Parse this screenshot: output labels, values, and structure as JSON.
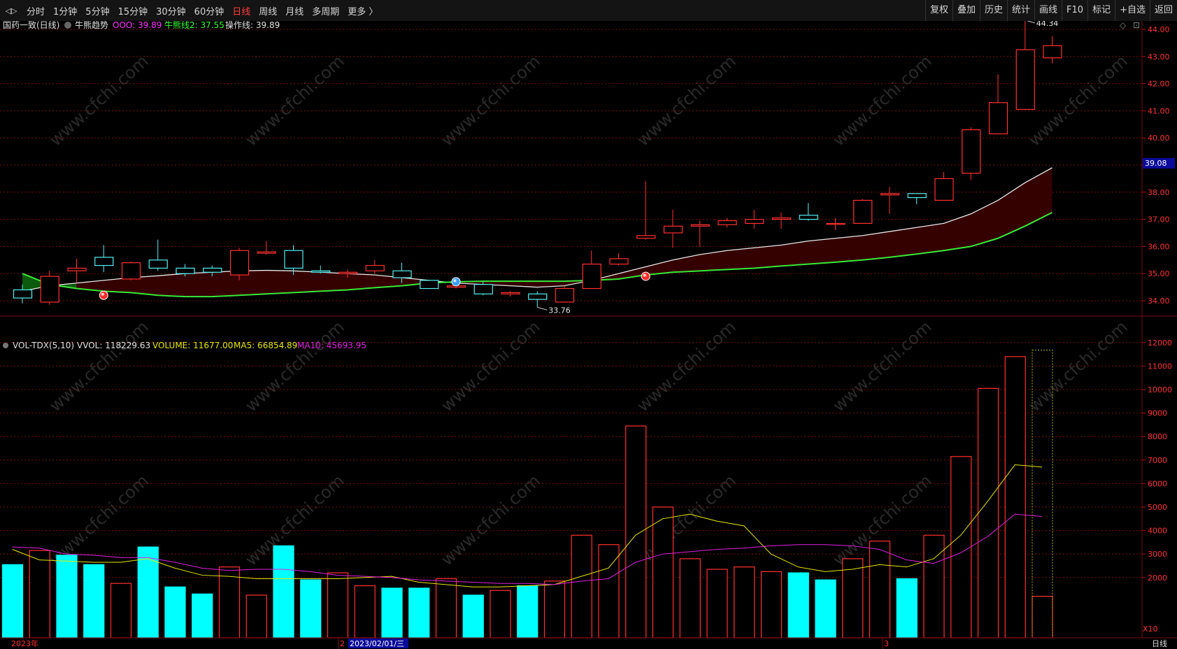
{
  "toolbar": {
    "nav_arrows": "◁▷",
    "periods": [
      "分时",
      "1分钟",
      "5分钟",
      "15分钟",
      "30分钟",
      "60分钟",
      "日线",
      "周线",
      "月线",
      "多周期",
      "更多 〉"
    ],
    "active_period": "日线",
    "right_buttons": [
      "复权",
      "叠加",
      "历史",
      "统计",
      "画线",
      "F10",
      "标记",
      "+自选",
      "返回"
    ]
  },
  "main_legend": {
    "stock": "国药一致(日线)",
    "indicator": "牛熊趋势",
    "ooo": "OOO: 39.89",
    "line2": "牛熊线2: 37.55",
    "op_line": "操作线: 39.89"
  },
  "vol_legend": {
    "name": "VOL-TDX(5,10)",
    "vvol": "VVOL: 118229.63",
    "volume": "VOLUME: 11677.00",
    "ma5": "MA5: 66854.89",
    "ma10": "MA10: 45693.95"
  },
  "price_labels": {
    "high": "44.34",
    "low": "33.76",
    "current": "39.08"
  },
  "vol_multiplier": "X10",
  "time_axis": {
    "labels": [
      "2023年",
      "2",
      "2023/02/01/三",
      "3"
    ],
    "mode": "日线"
  },
  "watermark": "www.cfchi.com",
  "colors": {
    "up": "#ff3030",
    "down": "#55f0f0",
    "bg": "#000000",
    "grid": "#7a0c0c",
    "ma_white": "#e8e8e8",
    "ma_green": "#39e839",
    "vol_ma5": "#e6e600",
    "vol_ma10": "#e020e0",
    "fill_dark": "#3a0000"
  },
  "chart_data": [
    {
      "type": "candlestick",
      "ylim": [
        33.5,
        44.5
      ],
      "yticks": [
        34,
        35,
        36,
        37,
        38,
        39,
        40,
        41,
        42,
        43,
        44
      ],
      "candles": [
        {
          "o": 34.4,
          "h": 34.6,
          "l": 33.9,
          "c": 34.1
        },
        {
          "o": 33.95,
          "h": 35.1,
          "l": 33.85,
          "c": 34.9
        },
        {
          "o": 35.1,
          "h": 35.55,
          "l": 34.65,
          "c": 35.2
        },
        {
          "o": 35.6,
          "h": 36.05,
          "l": 35.05,
          "c": 35.3
        },
        {
          "o": 34.8,
          "h": 35.45,
          "l": 34.75,
          "c": 35.4
        },
        {
          "o": 35.5,
          "h": 36.25,
          "l": 35.1,
          "c": 35.2
        },
        {
          "o": 35.2,
          "h": 35.35,
          "l": 34.9,
          "c": 35.0
        },
        {
          "o": 35.2,
          "h": 35.3,
          "l": 34.9,
          "c": 35.05
        },
        {
          "o": 34.95,
          "h": 35.95,
          "l": 34.75,
          "c": 35.85
        },
        {
          "o": 35.75,
          "h": 36.2,
          "l": 35.7,
          "c": 35.8
        },
        {
          "o": 35.85,
          "h": 36.05,
          "l": 34.95,
          "c": 35.2
        },
        {
          "o": 35.1,
          "h": 35.3,
          "l": 35.0,
          "c": 35.05
        },
        {
          "o": 35.0,
          "h": 35.15,
          "l": 34.85,
          "c": 35.05
        },
        {
          "o": 35.1,
          "h": 35.5,
          "l": 35.0,
          "c": 35.3
        },
        {
          "o": 35.1,
          "h": 35.4,
          "l": 34.65,
          "c": 34.85
        },
        {
          "o": 34.75,
          "h": 34.75,
          "l": 34.45,
          "c": 34.45
        },
        {
          "o": 34.5,
          "h": 34.6,
          "l": 34.45,
          "c": 34.55
        },
        {
          "o": 34.6,
          "h": 34.7,
          "l": 34.2,
          "c": 34.25
        },
        {
          "o": 34.25,
          "h": 34.35,
          "l": 34.15,
          "c": 34.3
        },
        {
          "o": 34.25,
          "h": 34.35,
          "l": 33.76,
          "c": 34.05
        },
        {
          "o": 33.95,
          "h": 34.55,
          "l": 33.95,
          "c": 34.45
        },
        {
          "o": 34.45,
          "h": 35.85,
          "l": 34.45,
          "c": 35.35
        },
        {
          "o": 35.35,
          "h": 35.75,
          "l": 35.3,
          "c": 35.55
        },
        {
          "o": 36.3,
          "h": 38.4,
          "l": 36.25,
          "c": 36.4
        },
        {
          "o": 36.5,
          "h": 37.35,
          "l": 35.95,
          "c": 36.75
        },
        {
          "o": 36.75,
          "h": 36.95,
          "l": 36.0,
          "c": 36.8
        },
        {
          "o": 36.8,
          "h": 37.05,
          "l": 36.7,
          "c": 36.95
        },
        {
          "o": 36.85,
          "h": 37.35,
          "l": 36.65,
          "c": 37.0
        },
        {
          "o": 37.0,
          "h": 37.25,
          "l": 36.65,
          "c": 37.05
        },
        {
          "o": 37.15,
          "h": 37.6,
          "l": 36.95,
          "c": 37.0
        },
        {
          "o": 36.85,
          "h": 37.05,
          "l": 36.6,
          "c": 36.85
        },
        {
          "o": 36.85,
          "h": 37.75,
          "l": 36.85,
          "c": 37.7
        },
        {
          "o": 37.9,
          "h": 38.2,
          "l": 37.2,
          "c": 37.95
        },
        {
          "o": 37.95,
          "h": 37.95,
          "l": 37.55,
          "c": 37.8
        },
        {
          "o": 37.7,
          "h": 38.75,
          "l": 37.7,
          "c": 38.5
        },
        {
          "o": 38.7,
          "h": 40.4,
          "l": 38.45,
          "c": 40.3
        },
        {
          "o": 40.15,
          "h": 42.35,
          "l": 40.15,
          "c": 41.3
        },
        {
          "o": 41.05,
          "h": 44.34,
          "l": 41.05,
          "c": 43.25
        },
        {
          "o": 42.95,
          "h": 43.75,
          "l": 42.75,
          "c": 43.4
        }
      ],
      "ma_white": [
        34.35,
        34.55,
        34.65,
        34.75,
        34.85,
        34.92,
        35.0,
        35.05,
        35.1,
        35.12,
        35.1,
        35.05,
        35.0,
        34.95,
        34.85,
        34.75,
        34.65,
        34.6,
        34.55,
        34.5,
        34.55,
        34.75,
        35.0,
        35.25,
        35.5,
        35.7,
        35.85,
        35.95,
        36.05,
        36.2,
        36.3,
        36.4,
        36.55,
        36.7,
        36.85,
        37.2,
        37.7,
        38.35,
        38.9
      ],
      "ma_green": [
        35.0,
        34.6,
        34.45,
        34.35,
        34.3,
        34.2,
        34.15,
        34.15,
        34.2,
        34.25,
        34.3,
        34.35,
        34.4,
        34.48,
        34.55,
        34.65,
        34.7,
        34.72,
        34.72,
        34.72,
        34.72,
        34.75,
        34.8,
        34.95,
        35.05,
        35.1,
        35.15,
        35.2,
        35.28,
        35.35,
        35.42,
        35.5,
        35.6,
        35.72,
        35.85,
        36.0,
        36.3,
        36.75,
        37.25
      ],
      "signals": [
        {
          "i": 3,
          "v": 34.2,
          "kind": "red"
        },
        {
          "i": 16,
          "v": 34.7,
          "kind": "blue"
        },
        {
          "i": 23,
          "v": 34.9,
          "kind": "red"
        }
      ]
    },
    {
      "type": "bar",
      "title": "VOL-TDX(5,10)",
      "ylim": [
        0,
        12500
      ],
      "yticks": [
        2000,
        3000,
        4000,
        5000,
        6000,
        7000,
        8000,
        9000,
        10000,
        11000,
        12000
      ],
      "volumes": [
        2550,
        3150,
        2950,
        2550,
        1750,
        3300,
        1600,
        1300,
        2450,
        1250,
        3350,
        1900,
        2200,
        1650,
        1550,
        1550,
        1950,
        1250,
        1450,
        1650,
        1850,
        3800,
        3400,
        8450,
        5000,
        2800,
        2350,
        2450,
        2250,
        2200,
        1900,
        2800,
        3550,
        1950,
        3800,
        7150,
        10050,
        11400,
        1200
      ],
      "up": [
        false,
        true,
        false,
        false,
        true,
        false,
        false,
        false,
        true,
        true,
        false,
        false,
        true,
        true,
        false,
        false,
        true,
        false,
        true,
        false,
        true,
        true,
        true,
        true,
        true,
        true,
        true,
        true,
        true,
        false,
        false,
        true,
        true,
        false,
        true,
        true,
        true,
        true,
        true
      ],
      "ma5": [
        3200,
        2750,
        2700,
        2650,
        2650,
        2800,
        2400,
        2100,
        2050,
        1950,
        1950,
        1950,
        1950,
        2000,
        2050,
        1800,
        1700,
        1600,
        1600,
        1650,
        1700,
        2050,
        2400,
        3800,
        4500,
        4700,
        4400,
        4200,
        3000,
        2450,
        2250,
        2350,
        2550,
        2450,
        2800,
        3800,
        5250,
        6800,
        6700
      ],
      "ma10": [
        3300,
        3250,
        3000,
        2950,
        2850,
        2850,
        2650,
        2400,
        2300,
        2350,
        2350,
        2250,
        2100,
        2050,
        2000,
        1900,
        1850,
        1800,
        1750,
        1750,
        1700,
        1850,
        1950,
        2650,
        3000,
        3100,
        3200,
        3250,
        3350,
        3400,
        3400,
        3350,
        3200,
        2750,
        2600,
        3050,
        3750,
        4700,
        4600
      ],
      "partial_frame_max": 11677
    }
  ]
}
